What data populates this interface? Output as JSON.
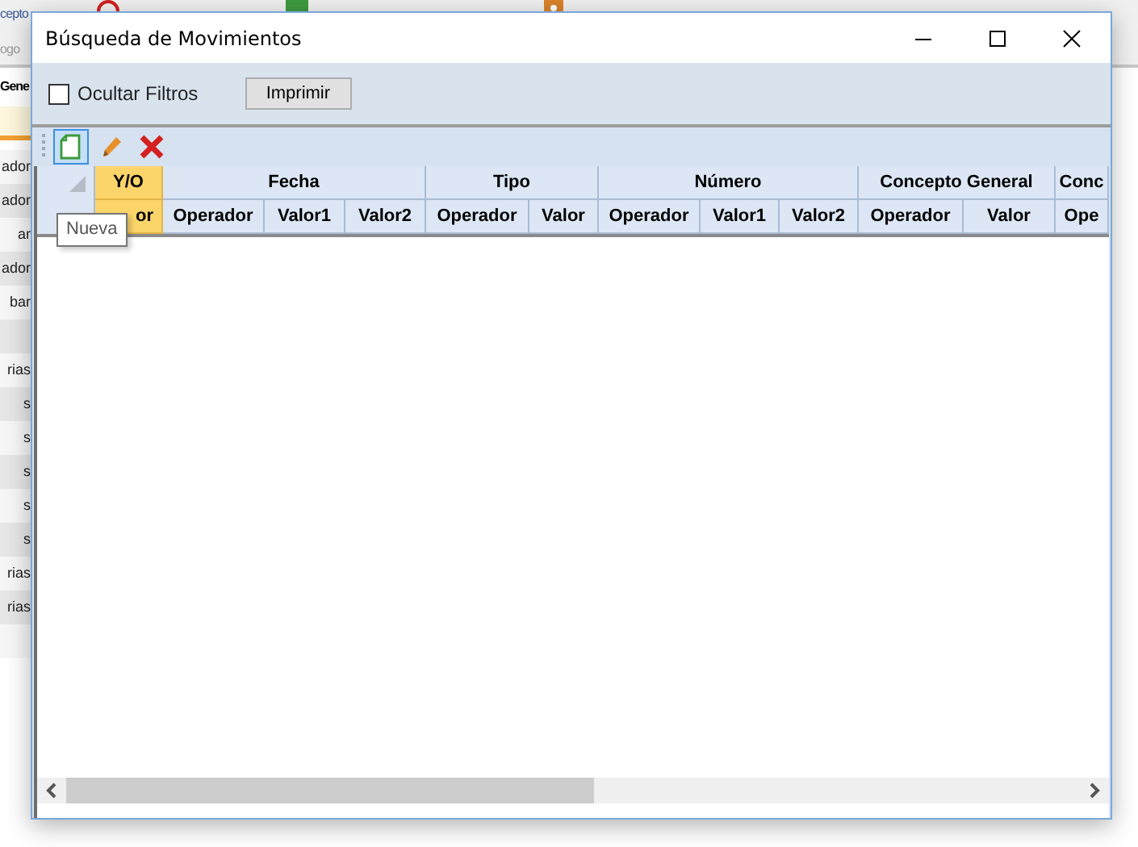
{
  "background_app": {
    "toolbar_texts": [
      "cepto",
      "ogo"
    ],
    "panel_header": "Gene",
    "list_items": [
      {
        "kind": "text",
        "text": "ador"
      },
      {
        "kind": "text",
        "text": "ador"
      },
      {
        "kind": "text",
        "text": "ar"
      },
      {
        "kind": "text",
        "text": "ador"
      },
      {
        "kind": "text",
        "text": "bar"
      },
      {
        "kind": "blank"
      },
      {
        "kind": "text",
        "text": "rias"
      },
      {
        "kind": "text",
        "text": "s"
      },
      {
        "kind": "text",
        "text": "s"
      },
      {
        "kind": "text",
        "text": "s"
      },
      {
        "kind": "text",
        "text": "s"
      },
      {
        "kind": "text",
        "text": "s"
      },
      {
        "kind": "text",
        "text": "rias"
      },
      {
        "kind": "text",
        "text": "rias"
      },
      {
        "kind": "blank"
      }
    ]
  },
  "window": {
    "title": "Búsqueda de Movimientos"
  },
  "filters": {
    "hide_filters": {
      "label": "Ocultar Filtros",
      "checked": false
    },
    "print_button": "Imprimir"
  },
  "toolbar": {
    "buttons": [
      {
        "kind": "new",
        "hovered": true
      },
      {
        "kind": "edit",
        "hovered": false
      },
      {
        "kind": "delete",
        "hovered": false
      }
    ]
  },
  "tooltip": "Nueva",
  "grid": {
    "groups": [
      {
        "label": "Y/O",
        "highlighted": true,
        "columns": [
          "or"
        ]
      },
      {
        "label": "Fecha",
        "highlighted": false,
        "columns": [
          "Operador",
          "Valor1",
          "Valor2"
        ]
      },
      {
        "label": "Tipo",
        "highlighted": false,
        "columns": [
          "Operador",
          "Valor"
        ]
      },
      {
        "label": "Número",
        "highlighted": false,
        "columns": [
          "Operador",
          "Valor1",
          "Valor2"
        ]
      },
      {
        "label": "Concepto General",
        "highlighted": false,
        "columns": [
          "Operador",
          "Valor"
        ]
      },
      {
        "label": "Conc",
        "highlighted": false,
        "columns": [
          "Ope"
        ]
      }
    ]
  }
}
